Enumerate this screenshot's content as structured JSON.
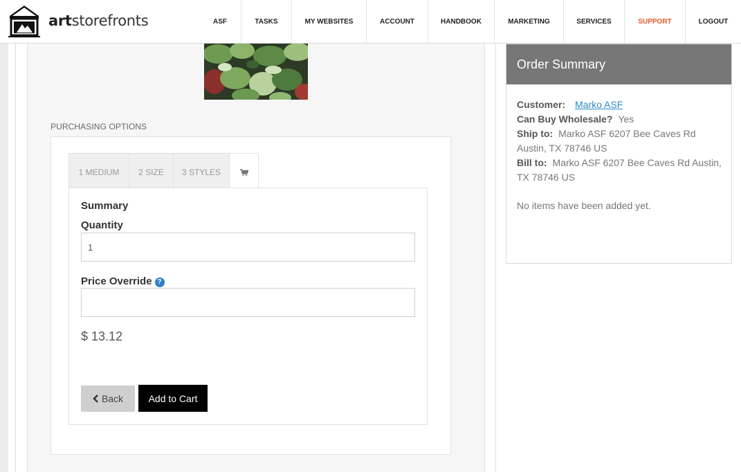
{
  "brand": {
    "name_bold": "art",
    "name_rest": "storefronts",
    "logo_icon": "storefront-awning-logo"
  },
  "nav": [
    {
      "label": "ASF"
    },
    {
      "label": "TASKS"
    },
    {
      "label": "MY WEBSITES"
    },
    {
      "label": "ACCOUNT"
    },
    {
      "label": "HANDBOOK"
    },
    {
      "label": "MARKETING"
    },
    {
      "label": "SERVICES"
    },
    {
      "label": "SUPPORT",
      "color": "#e25a2b"
    },
    {
      "label": "LOGOUT"
    }
  ],
  "purchasing": {
    "section_label": "PURCHASING OPTIONS",
    "tabs": [
      {
        "label": "1 MEDIUM"
      },
      {
        "label": "2 SIZE"
      },
      {
        "label": "3 STYLES"
      },
      {
        "label": "",
        "icon": "cart-icon",
        "active": true
      }
    ],
    "summary_heading": "Summary",
    "quantity_label": "Quantity",
    "quantity_value": "1",
    "price_override_label": "Price Override",
    "price_override_value": "",
    "help_icon": "question-circle-icon",
    "price": "$ 13.12",
    "back_label": "Back",
    "add_to_cart_label": "Add to Cart"
  },
  "order_summary": {
    "title": "Order Summary",
    "customer_label": "Customer:",
    "customer_name": "Marko ASF",
    "wholesale_label": "Can Buy Wholesale?",
    "wholesale_value": "Yes",
    "ship_label": "Ship to:",
    "ship_value": "Marko ASF 6207 Bee Caves Rd Austin, TX 78746 US",
    "bill_label": "Bill to:",
    "bill_value": "Marko ASF 6207 Bee Caves Rd Austin, TX 78746 US",
    "empty_message": "No items have been added yet."
  },
  "colors": {
    "accent_support": "#e25a2b",
    "link": "#2b8bc6",
    "summary_header_bg": "#777777",
    "primary_button": "#000000"
  }
}
